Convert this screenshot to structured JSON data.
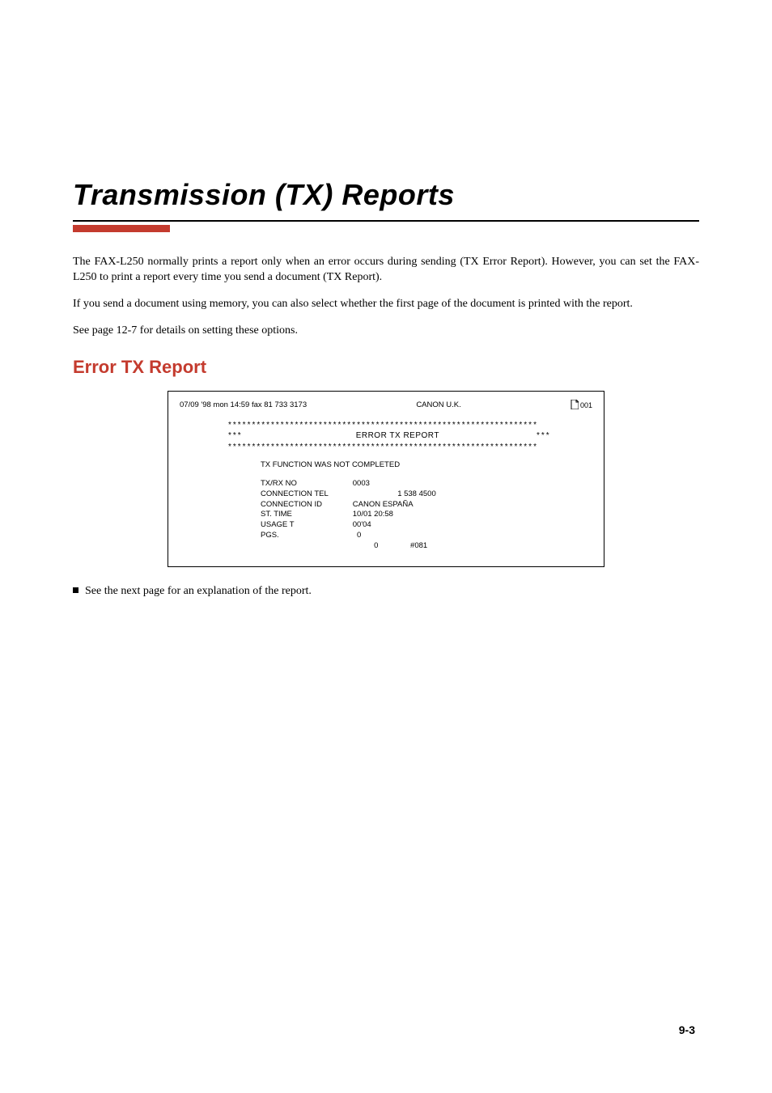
{
  "title": "Transmission (TX) Reports",
  "paragraphs": {
    "p1": "The FAX-L250 normally prints a report only when an error occurs during sending (TX Error Report). However, you can set the FAX-L250 to print a report every time you send a document (TX Report).",
    "p2": "If you send a document using memory, you can also select whether the first page of the document is printed with the report.",
    "p3": "See page 12-7 for details on setting these options."
  },
  "section_heading": "Error TX Report",
  "report": {
    "header_left": "07/09 '98 mon 14:59 fax 81 733 3173",
    "header_center": "CANON U.K.",
    "header_right": "001",
    "ast_line": "*****************************************************************",
    "ast_stars": "***",
    "report_title": "ERROR TX REPORT",
    "status_line": "TX FUNCTION WAS NOT COMPLETED",
    "rows": [
      {
        "k": "TX/RX NO",
        "v": "0003"
      },
      {
        "k": "CONNECTION TEL",
        "v": "                     1 538 4500"
      },
      {
        "k": "CONNECTION ID",
        "v": "CANON ESPAÑA"
      },
      {
        "k": "ST. TIME",
        "v": "10/01 20:58"
      },
      {
        "k": "USAGE T",
        "v": "00'04"
      },
      {
        "k": "PGS.",
        "v": "  0"
      }
    ],
    "last_line": "          0               #081"
  },
  "footnote": "See the next page for an explanation of the report.",
  "page_number": "9-3"
}
